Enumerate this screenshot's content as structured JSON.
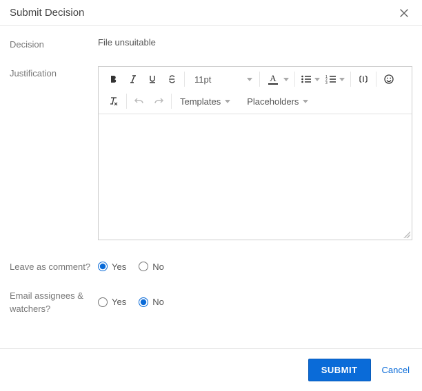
{
  "dialog": {
    "title": "Submit Decision"
  },
  "fields": {
    "decision_label": "Decision",
    "decision_value": "File unsuitable",
    "justification_label": "Justification",
    "leave_comment_label": "Leave as comment?",
    "email_label": "Email assignees & watchers?"
  },
  "toolbar": {
    "font_size": "11pt",
    "templates_label": "Templates",
    "placeholders_label": "Placeholders"
  },
  "radios": {
    "yes": "Yes",
    "no": "No"
  },
  "footer": {
    "submit": "SUBMIT",
    "cancel": "Cancel"
  }
}
